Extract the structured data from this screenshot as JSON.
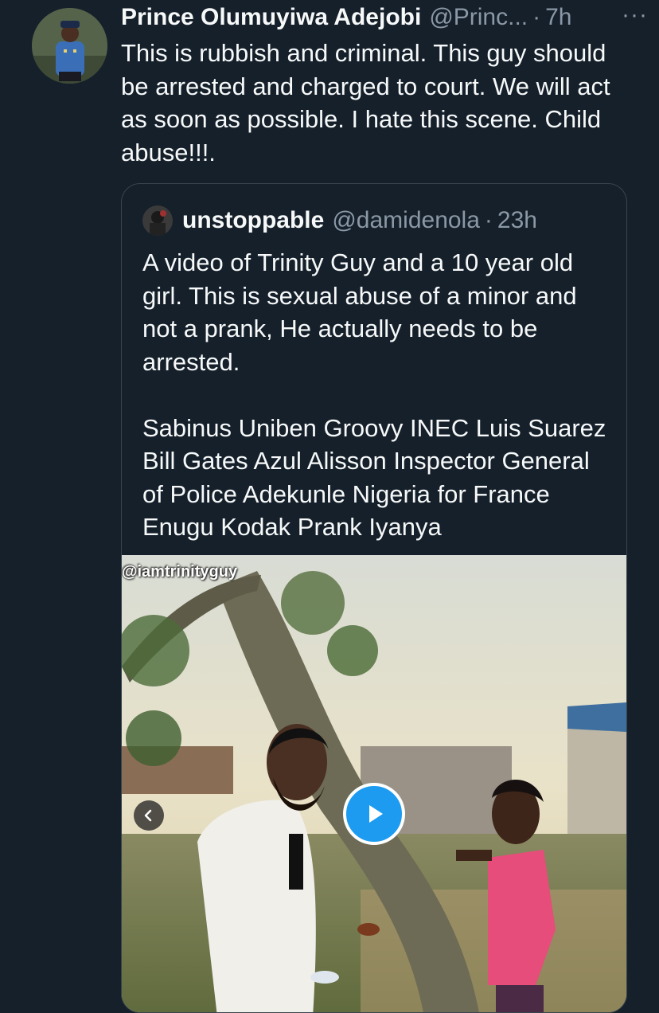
{
  "tweet": {
    "author_name": "Prince Olumuyiwa Adejobi",
    "author_handle": "@Princ...",
    "separator": "·",
    "time": "7h",
    "more": "···",
    "text": "This is rubbish and criminal. This guy should be arrested and charged to court. We will act as soon as possible.  I hate this scene. Child abuse!!!."
  },
  "quoted": {
    "author_name": "unstoppable",
    "author_handle": "@damidenola",
    "separator": "·",
    "time": "23h",
    "text": "A video of Trinity Guy and a 10 year old girl. This is sexual abuse of a minor and not a prank, He actually needs to be arrested.\n\n Sabinus Uniben Groovy INEC Luis Suarez Bill Gates Azul Alisson Inspector General of Police Adekunle Nigeria for France Enugu Kodak Prank Iyanya",
    "media": {
      "watermark": "@iamtrinityguy",
      "play_icon": "play-icon",
      "prev_icon": "chevron-left-icon"
    }
  },
  "colors": {
    "background": "#15202b",
    "text": "#f7f9f9",
    "muted": "#8b98a5",
    "accent": "#1d9bf0",
    "border": "#38444d"
  }
}
